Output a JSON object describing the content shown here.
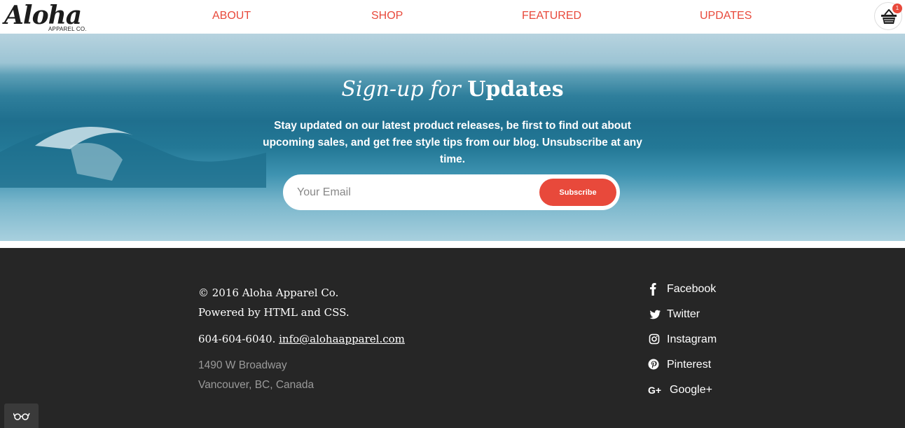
{
  "logo": {
    "script": "Aloha",
    "sub": "APPAREL CO."
  },
  "nav": {
    "items": [
      {
        "label": "ABOUT"
      },
      {
        "label": "SHOP"
      },
      {
        "label": "FEATURED"
      },
      {
        "label": "UPDATES"
      }
    ],
    "cart": {
      "icon": "basket-icon",
      "count": "1"
    }
  },
  "hero": {
    "title_italic": "Sign-up for",
    "title_bold": "Updates",
    "text": "Stay updated on our latest product releases, be first to find out about upcoming sales, and get free style tips from our blog. Unsubscribe at any time.",
    "email_placeholder": "Your Email",
    "email_value": "",
    "subscribe_label": "Subscribe"
  },
  "footer": {
    "copyright": "© 2016 Aloha Apparel Co.",
    "powered": "Powered by HTML and CSS.",
    "phone": "604-604-6040.",
    "email": "info@alohaapparel.com",
    "address_line1": "1490 W Broadway",
    "address_line2": "Vancouver, BC, Canada",
    "social": [
      {
        "label": "Facebook",
        "icon": "facebook-icon"
      },
      {
        "label": "Twitter",
        "icon": "twitter-icon"
      },
      {
        "label": "Instagram",
        "icon": "instagram-icon"
      },
      {
        "label": "Pinterest",
        "icon": "pinterest-icon"
      },
      {
        "label": "Google+",
        "icon": "google-plus-icon"
      }
    ]
  },
  "colors": {
    "accent": "#e8493b",
    "footer_bg": "#262626",
    "footer_muted": "#9a9a9a"
  }
}
